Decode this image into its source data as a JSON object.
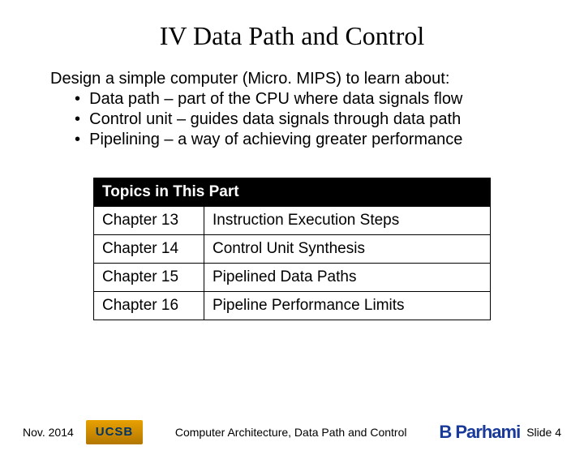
{
  "title": "IV  Data Path and Control",
  "intro": "Design a simple computer (Micro. MIPS) to learn about:",
  "bullets": [
    "Data path – part of the CPU where data signals flow",
    "Control unit – guides data signals through data path",
    "Pipelining – a way of achieving greater performance"
  ],
  "topics_header": "Topics in This Part",
  "chapters": [
    {
      "label": "Chapter 13",
      "title": "Instruction Execution Steps"
    },
    {
      "label": "Chapter 14",
      "title": "Control Unit Synthesis"
    },
    {
      "label": "Chapter 15",
      "title": "Pipelined Data Paths"
    },
    {
      "label": "Chapter 16",
      "title": "Pipeline Performance Limits"
    }
  ],
  "footer": {
    "date": "Nov. 2014",
    "logo_text": "UCSB",
    "center": "Computer Architecture, Data Path and Control",
    "author": "B Parhami",
    "slide": "Slide 4"
  }
}
